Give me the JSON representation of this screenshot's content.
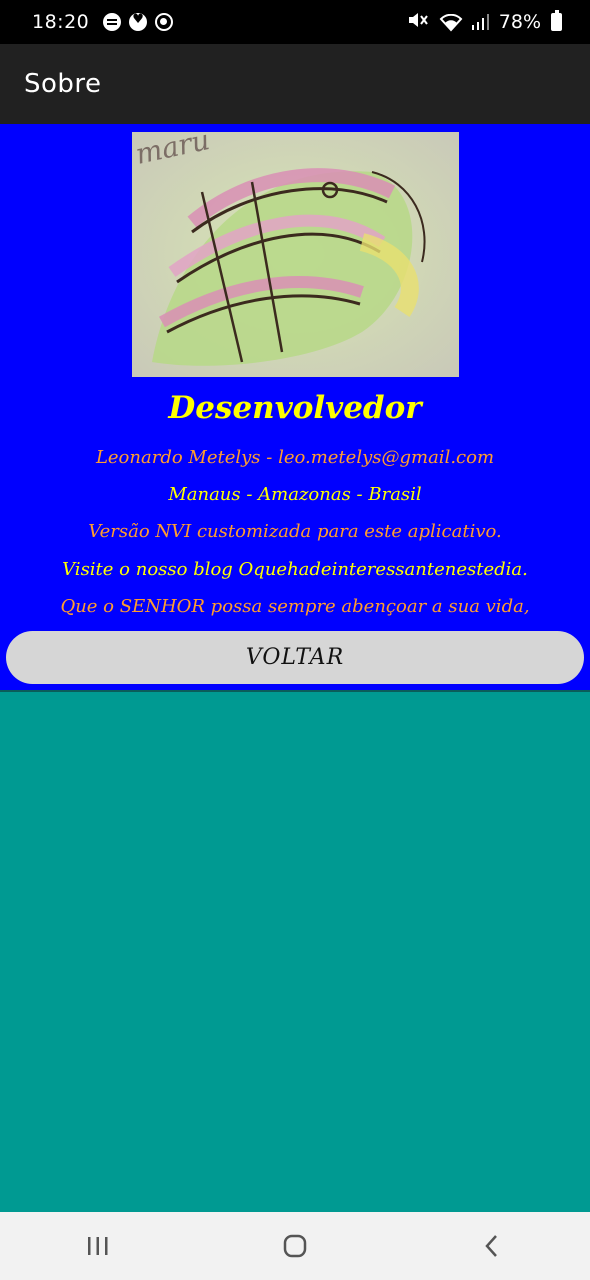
{
  "status_bar": {
    "time": "18:20",
    "battery": "78%",
    "icons_left": [
      "message-icon",
      "heart-icon",
      "ring-icon"
    ],
    "icons_right": [
      "mute-icon",
      "wifi-icon",
      "signal-icon",
      "battery-icon"
    ]
  },
  "app_bar": {
    "title": "Sobre"
  },
  "content": {
    "heading": "Desenvolvedor",
    "lines": [
      "Leonardo Metelys - leo.metelys@gmail.com",
      "Manaus - Amazonas - Brasil",
      "Versão NVI customizada para este aplicativo.",
      "Visite o nosso blog Oquehadeinteressantenestedia.",
      "Que o SENHOR possa sempre abençoar a sua vida,"
    ],
    "button_label": "VOLTAR"
  },
  "colors": {
    "content_bg": "#0000ff",
    "heading": "#ffff00",
    "orange_text": "#ff9d2e",
    "yellow_text": "#ffff00",
    "teal": "#009a92",
    "app_bar": "#212121"
  }
}
